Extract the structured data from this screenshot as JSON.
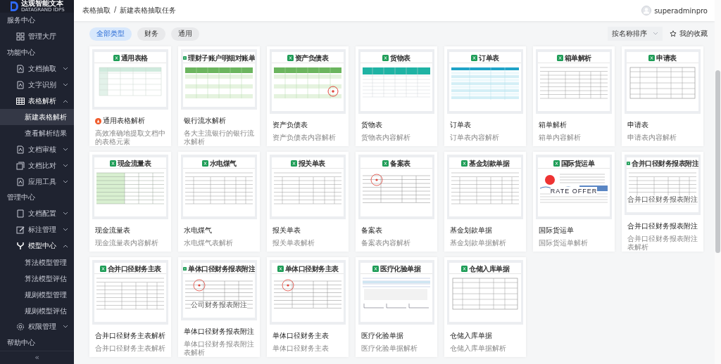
{
  "sidebar": {
    "logo": {
      "name": "达观智能文本",
      "subtitle": "DATAGRAND IDPS"
    },
    "sections": [
      {
        "label": "服务中心",
        "items": [
          {
            "label": "管理大厅"
          }
        ]
      },
      {
        "label": "功能中心",
        "items": [
          {
            "label": "文档抽取",
            "expanded": false
          },
          {
            "label": "文字识别",
            "expanded": false
          },
          {
            "label": "表格解析",
            "expanded": true,
            "children": [
              {
                "label": "新建表格解析",
                "selected": true
              },
              {
                "label": "查看解析结果",
                "selected": false
              }
            ]
          },
          {
            "label": "文档审核",
            "expanded": false
          },
          {
            "label": "文档比对",
            "expanded": false
          },
          {
            "label": "应用工具",
            "expanded": false
          }
        ]
      },
      {
        "label": "管理中心",
        "items": [
          {
            "label": "文档配置",
            "expanded": false
          },
          {
            "label": "标注管理",
            "expanded": false
          },
          {
            "label": "模型中心",
            "expanded": true,
            "children": [
              {
                "label": "算法模型管理",
                "selected": false
              },
              {
                "label": "算法模型评估",
                "selected": false
              },
              {
                "label": "规则模型管理",
                "selected": false
              },
              {
                "label": "规则模型评估",
                "selected": false
              }
            ]
          },
          {
            "label": "权限管理",
            "expanded": false
          }
        ]
      },
      {
        "label": "帮助中心"
      }
    ],
    "collapse": "«"
  },
  "breadcrumb": [
    {
      "label": "表格抽取"
    },
    {
      "label": "/"
    },
    {
      "label": "新建表格抽取任务"
    }
  ],
  "user": {
    "name": "superadminpro"
  },
  "filters": [
    {
      "label": "全部类型",
      "selected": true
    },
    {
      "label": "财务",
      "selected": false
    },
    {
      "label": "通用",
      "selected": false
    }
  ],
  "sort": {
    "value": "按名称排序"
  },
  "favorites": {
    "label": "我的收藏"
  },
  "cards": [
    {
      "thumb_title": "通用表格",
      "title": "通用表格解析",
      "desc": "高效准确地提取文档中的表格元素",
      "hot": true
    },
    {
      "thumb_title": "理财子账户明细对账单",
      "title": "银行流水解析",
      "desc": "各大主流银行的银行流水解析",
      "hot": false
    },
    {
      "thumb_title": "资产负债表",
      "title": "资产负债表",
      "desc": "资产负债表内容解析",
      "hot": false
    },
    {
      "thumb_title": "货物表",
      "title": "货物表",
      "desc": "货物表内容解析",
      "hot": false
    },
    {
      "thumb_title": "订单表",
      "title": "订单表",
      "desc": "订单表内容解析",
      "hot": false
    },
    {
      "thumb_title": "箱单解析",
      "title": "箱单解析",
      "desc": "箱单内容解析",
      "hot": false
    },
    {
      "thumb_title": "申请表",
      "title": "申请表",
      "desc": "申请表内容解析",
      "hot": false
    },
    {
      "thumb_title": "现金流量表",
      "title": "现金流量表",
      "desc": "现金流量表内容解析",
      "hot": false
    },
    {
      "thumb_title": "水电煤气",
      "title": "水电煤气",
      "desc": "水电煤气表解析",
      "hot": false
    },
    {
      "thumb_title": "报关单表",
      "title": "报关单表",
      "desc": "报关单表解析",
      "hot": false
    },
    {
      "thumb_title": "备案表",
      "title": "备案表",
      "desc": "备案表内容解析",
      "hot": false
    },
    {
      "thumb_title": "基金划款单据",
      "title": "基金划款单据",
      "desc": "基金划款单据解析",
      "hot": false
    },
    {
      "thumb_title": "国际货运单",
      "thumb_caption": "RATE OFFER",
      "title": "国际货运单",
      "desc": "国际货运单解析",
      "hot": false
    },
    {
      "thumb_title": "合并口径财务报表附注",
      "thumb_caption": "合并口径财务报表附注",
      "title": "合并口径财务报表附注",
      "desc": "合并口径财务报表附注表解析",
      "hot": false
    },
    {
      "thumb_title": "合并口径财务主表",
      "title": "合并口径财务主表解析",
      "desc": "合并口径财务主表解析",
      "hot": false
    },
    {
      "thumb_title": "单体口径财务报表附注",
      "thumb_caption": "公司财务报表附注",
      "title": "单体口径财务报表附注",
      "desc": "单体口径财务报表附注表解析",
      "hot": false
    },
    {
      "thumb_title": "单体口径财务主表",
      "title": "单体口径财务主表",
      "desc": "单体口径财务主表",
      "hot": false
    },
    {
      "thumb_title": "医疗化验单据",
      "title": "医疗化验单据",
      "desc": "医疗化验单据解析",
      "hot": false
    },
    {
      "thumb_title": "仓储入库单据",
      "title": "仓储入库单据",
      "desc": "仓储入库单据解析",
      "hot": false
    }
  ]
}
